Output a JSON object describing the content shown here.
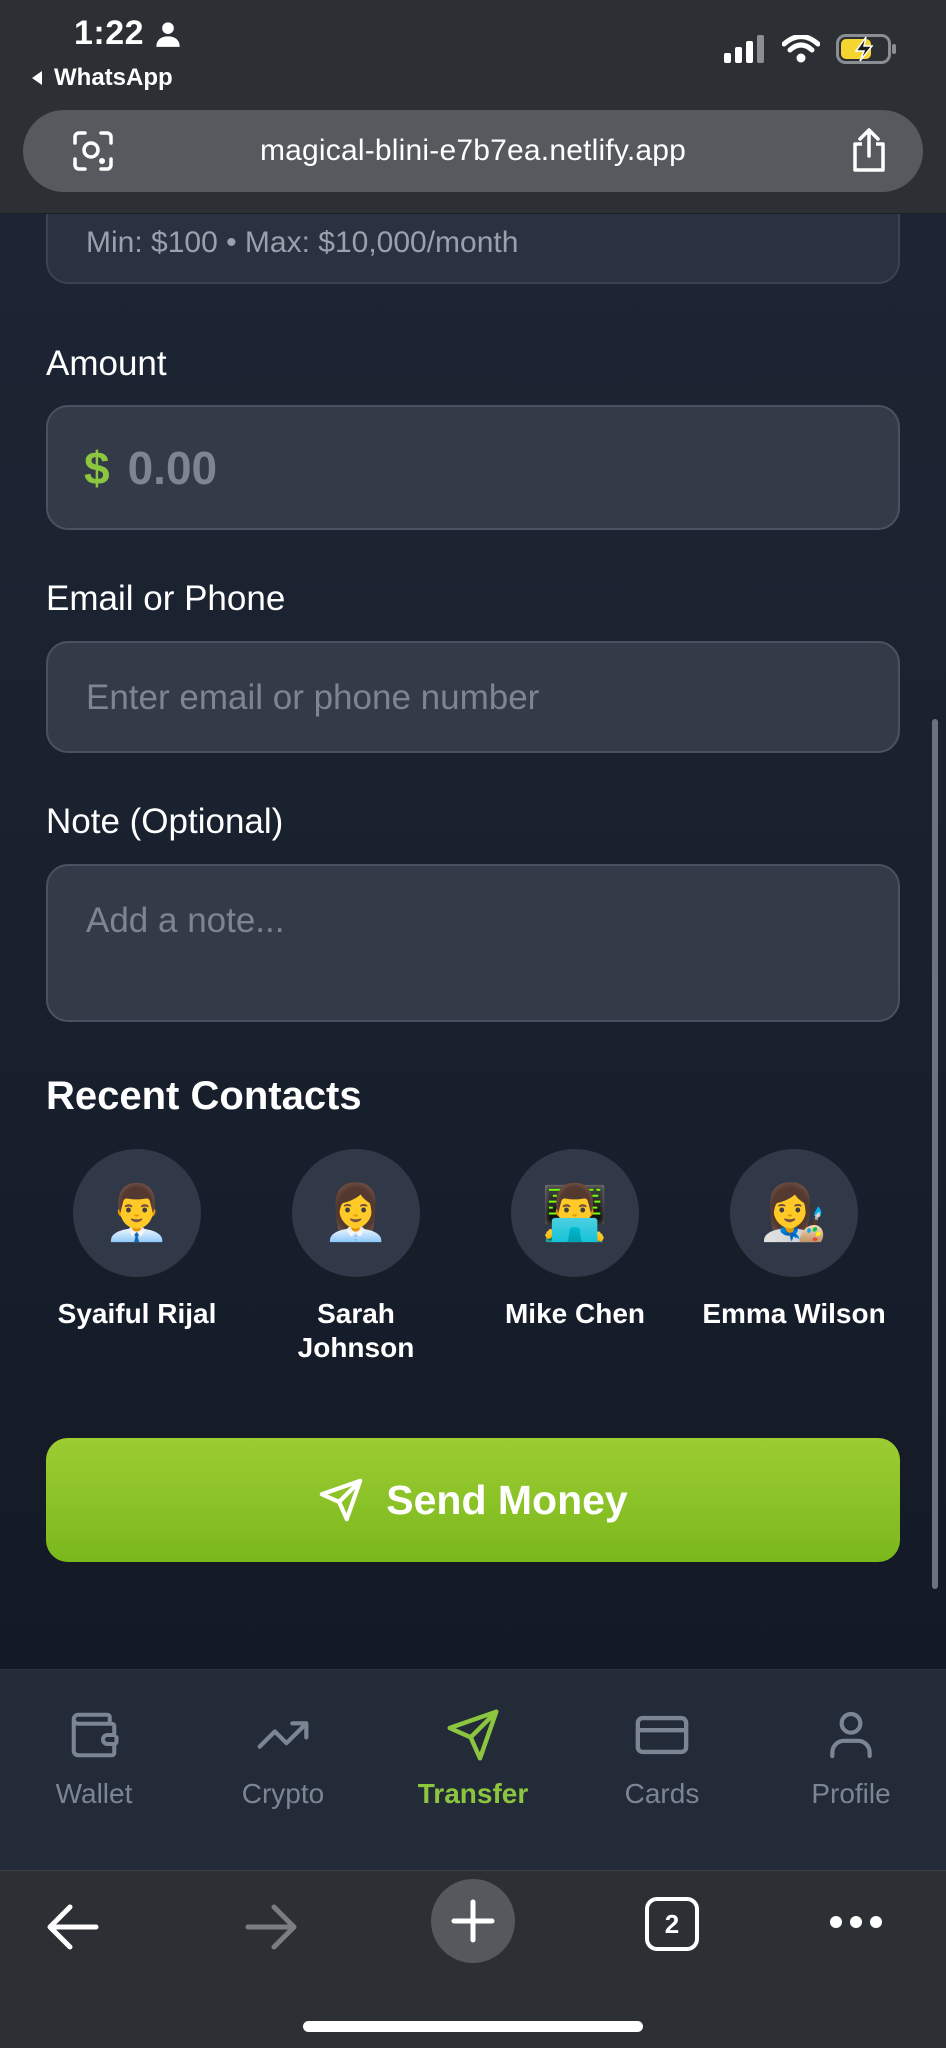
{
  "status": {
    "time": "1:22",
    "back_label": "WhatsApp"
  },
  "browser": {
    "url": "magical-blini-e7b7ea.netlify.app",
    "tab_count": "2"
  },
  "form": {
    "limit_text": "Min: $100 • Max: $10,000/month",
    "amount_label": "Amount",
    "currency_symbol": "$",
    "amount_placeholder": "0.00",
    "contact_label": "Email or Phone",
    "contact_placeholder": "Enter email or phone number",
    "note_label": "Note (Optional)",
    "note_placeholder": "Add a note..."
  },
  "recent_contacts": {
    "title": "Recent Contacts",
    "items": [
      {
        "emoji": "👨‍💼",
        "name": "Syaiful Rijal"
      },
      {
        "emoji": "👩‍💼",
        "name": "Sarah Johnson"
      },
      {
        "emoji": "👨‍💻",
        "name": "Mike Chen"
      },
      {
        "emoji": "👩‍🎨",
        "name": "Emma Wilson"
      }
    ]
  },
  "actions": {
    "send_label": "Send Money"
  },
  "tabbar": {
    "items": [
      {
        "label": "Wallet",
        "icon": "wallet-icon"
      },
      {
        "label": "Crypto",
        "icon": "trending-up-icon"
      },
      {
        "label": "Transfer",
        "icon": "send-icon",
        "active": true
      },
      {
        "label": "Cards",
        "icon": "credit-card-icon"
      },
      {
        "label": "Profile",
        "icon": "user-icon"
      }
    ]
  },
  "colors": {
    "accent": "#8cc63f",
    "background": "#1a2130",
    "field": "#343b48"
  }
}
